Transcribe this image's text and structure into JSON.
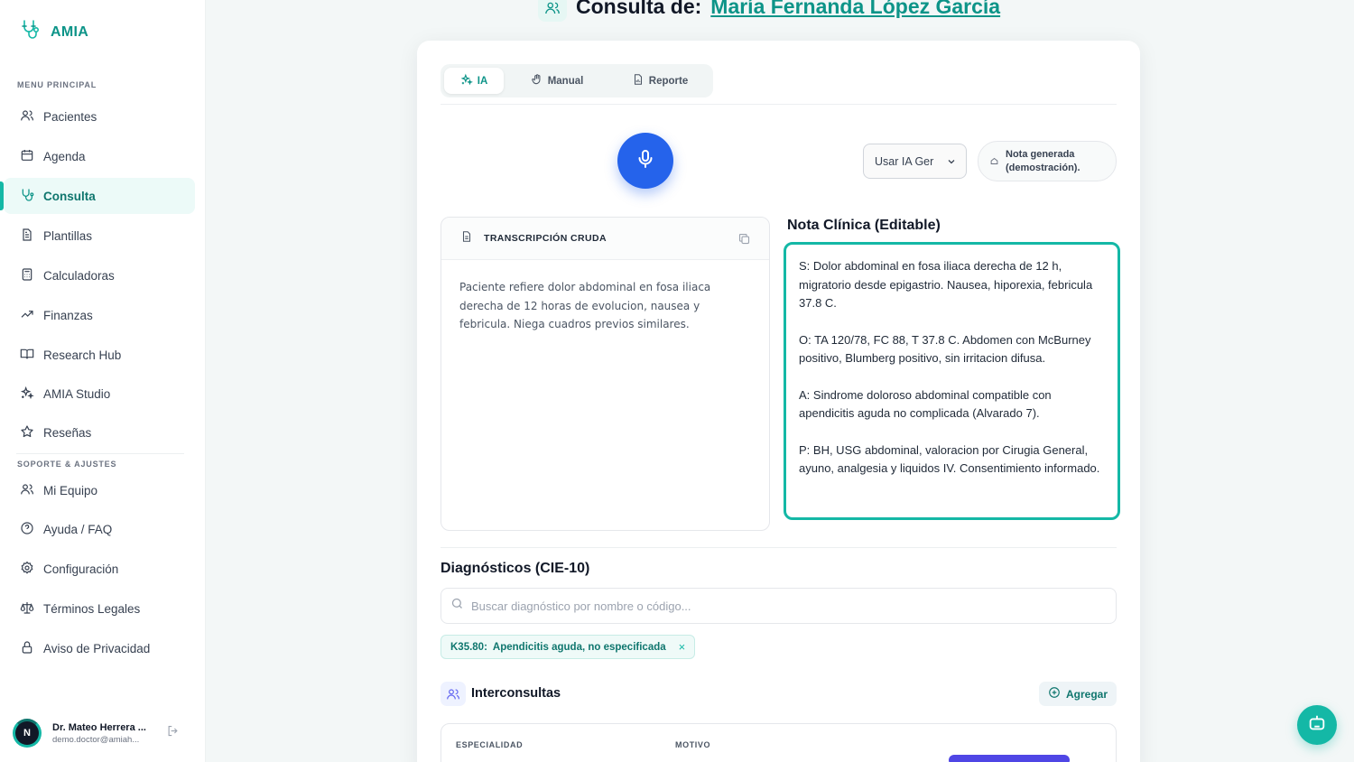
{
  "brand": {
    "name": "AMIA"
  },
  "sidebar": {
    "section_main": "MENU PRINCIPAL",
    "section_support": "SOPORTE & AJUSTES",
    "items": [
      {
        "label": "Pacientes",
        "icon": "users-icon"
      },
      {
        "label": "Agenda",
        "icon": "calendar-icon"
      },
      {
        "label": "Consulta",
        "icon": "stethoscope-icon",
        "active": true
      },
      {
        "label": "Plantillas",
        "icon": "document-icon"
      },
      {
        "label": "Calculadoras",
        "icon": "calculator-icon"
      },
      {
        "label": "Finanzas",
        "icon": "trend-up-icon"
      },
      {
        "label": "Research Hub",
        "icon": "book-open-icon"
      },
      {
        "label": "AMIA Studio",
        "icon": "sparkles-icon"
      },
      {
        "label": "Reseñas",
        "icon": "star-icon"
      }
    ],
    "support_items": [
      {
        "label": "Mi Equipo",
        "icon": "team-icon"
      },
      {
        "label": "Ayuda / FAQ",
        "icon": "help-circle-icon"
      },
      {
        "label": "Configuración",
        "icon": "gear-icon"
      },
      {
        "label": "Términos Legales",
        "icon": "scale-icon"
      },
      {
        "label": "Aviso de Privacidad",
        "icon": "lock-icon"
      }
    ],
    "user": {
      "initial": "N",
      "name": "Dr. Mateo Herrera ...",
      "email": "demo.doctor@amiah..."
    }
  },
  "header": {
    "title": "Consulta de:",
    "patient": "María Fernanda López García"
  },
  "tabs": [
    {
      "label": "IA",
      "icon": "sparkles-icon",
      "active": true
    },
    {
      "label": "Manual",
      "icon": "hand-icon"
    },
    {
      "label": "Reporte",
      "icon": "report-icon"
    }
  ],
  "controls": {
    "model_select": "Usar IA Ger",
    "status_line1": "Nota generada",
    "status_line2": "(demostración)."
  },
  "transcription": {
    "title": "TRANSCRIPCIÓN CRUDA",
    "text": "Paciente refiere dolor abdominal en fosa iliaca derecha de 12 horas de evolucion, nausea y febricula. Niega cuadros previos similares."
  },
  "clinical_note": {
    "title": "Nota Clínica (Editable)",
    "s": "S: Dolor abdominal en fosa iliaca derecha de 12 h, migratorio desde epigastrio. Nausea, hiporexia, febricula 37.8 C.",
    "o": "O: TA 120/78, FC 88, T 37.8 C. Abdomen con McBurney positivo, Blumberg positivo, sin irritacion difusa.",
    "a": "A: Sindrome doloroso abdominal compatible con apendicitis aguda no complicada (Alvarado 7).",
    "p": "P: BH, USG abdominal, valoracion por Cirugia General, ayuno, analgesia y liquidos IV. Consentimiento informado."
  },
  "diagnoses": {
    "title": "Diagnósticos (CIE-10)",
    "search_placeholder": "Buscar diagnóstico por nombre o código...",
    "chip_code": "K35.80:",
    "chip_label": "Apendicitis aguda, no especificada",
    "chip_remove": "×"
  },
  "interconsultas": {
    "title": "Interconsultas",
    "add_label": "Agregar",
    "col_especialidad": "ESPECIALIDAD",
    "col_motivo": "MOTIVO"
  },
  "colors": {
    "accent": "#14b8a6",
    "primary_blue": "#2563eb",
    "indigo": "#4f46e5"
  }
}
